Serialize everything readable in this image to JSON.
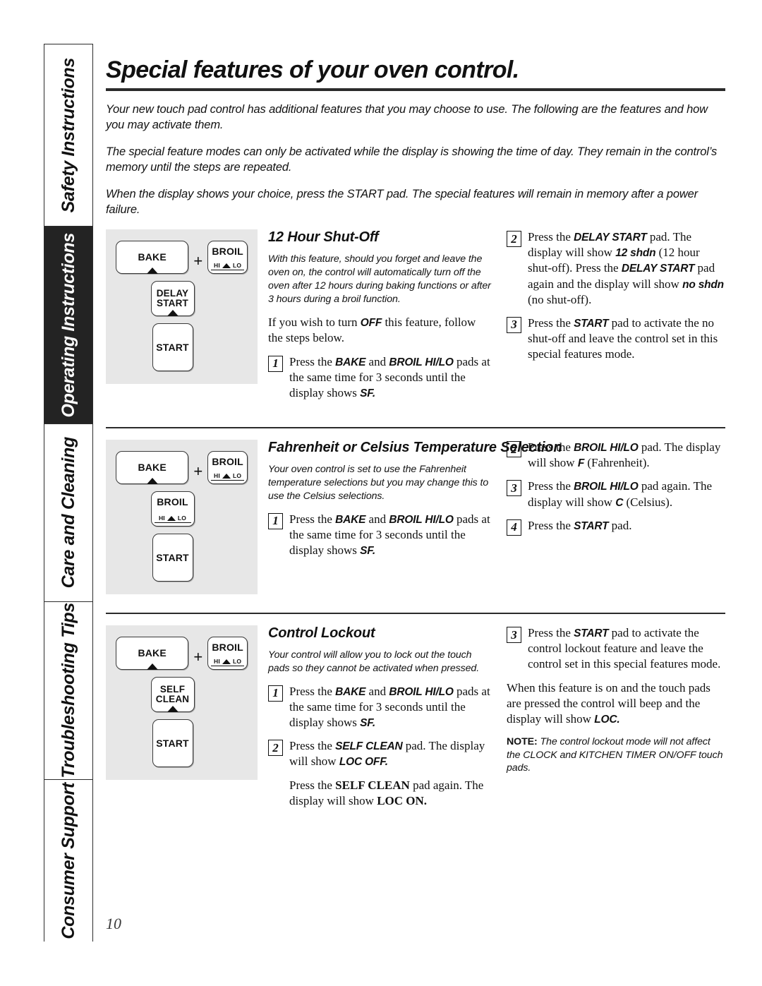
{
  "page": {
    "title": "Special features of your oven control.",
    "number": "10"
  },
  "tabs": [
    {
      "label": "Safety Instructions",
      "active": false
    },
    {
      "label": "Operating Instructions",
      "active": true
    },
    {
      "label": "Care and Cleaning",
      "active": false
    },
    {
      "label": "Troubleshooting Tips",
      "active": false
    },
    {
      "label": "Consumer Support",
      "active": false
    }
  ],
  "intro": {
    "p1": "Your new touch pad control has additional features that you may choose to use. The following are the features and how you may activate them.",
    "p2": "The special feature modes can only be activated while the display is showing the time of day. They remain in the control’s memory until the steps are repeated.",
    "p3": "When the display shows your choice, press the START pad. The special features will remain in memory after a power failure."
  },
  "keys": {
    "bake": "BAKE",
    "broil": "BROIL",
    "hi": "HI",
    "lo": "LO",
    "plus": "+",
    "delay_start_line1": "DELAY",
    "delay_start_line2": "START",
    "self_clean_line1": "SELF",
    "self_clean_line2": "CLEAN",
    "start": "START"
  },
  "sections": [
    {
      "id": "12-hour-shut-off",
      "title": "12 Hour Shut-Off",
      "blurb": "With this feature, should you forget and leave the oven on, the control will automatically turn off the oven after 12 hours during baking functions or after 3 hours during a broil function.",
      "lead_html": "If you wish to turn <b>OFF</b> this feature, follow the steps below.",
      "steps_left": [
        {
          "num": "1",
          "html": "Press the <b>BAKE</b> and <b>BROIL HI/LO</b> pads at the same time for 3 seconds until the display shows <b>SF.</b>"
        }
      ],
      "steps_right": [
        {
          "num": "2",
          "html": "Press the <b>DELAY START</b> pad. The display will show <b>12 shdn</b> (12 hour shut-off). Press the <b>DELAY START</b> pad again and the display will show <b>no shdn</b> (no shut-off)."
        },
        {
          "num": "3",
          "html": "Press the <b>START</b> pad to activate the no shut-off and leave the control set in this special features mode."
        }
      ]
    },
    {
      "id": "fahrenheit-or-celsius",
      "title": "Fahrenheit or Celsius Temperature Selection",
      "blurb": "Your oven control is set to use the Fahrenheit temperature selections but you may change this to use the Celsius selections.",
      "lead_html": "",
      "steps_left": [
        {
          "num": "1",
          "html": "Press the <b>BAKE</b> and <b>BROIL HI/LO</b> pads at the same time for 3 seconds until the display shows <b>SF.</b>"
        }
      ],
      "steps_right": [
        {
          "num": "2",
          "html": "Press the <b>BROIL HI/LO</b> pad. The display will show <b>F</b> (Fahrenheit)."
        },
        {
          "num": "3",
          "html": "Press the <b>BROIL HI/LO</b> pad again. The display will show <b>C</b> (Celsius)."
        },
        {
          "num": "4",
          "html": "Press the <b>START</b> pad."
        }
      ]
    },
    {
      "id": "control-lockout",
      "title": "Control Lockout",
      "blurb": "Your control will allow you to lock out the touch pads so they cannot be activated when pressed.",
      "lead_html": "",
      "steps_left": [
        {
          "num": "1",
          "html": "Press the <b>BAKE</b> and <b>BROIL HI/LO</b> pads at the same time for 3 seconds until the display shows <b>SF.</b>"
        },
        {
          "num": "2",
          "html": "Press the <b>SELF CLEAN</b> pad. The display will show <b>LOC OFF.</b>"
        }
      ],
      "continuation_html": "Press the <b>SELF CLEAN</b> pad again. The display will show <b>LOC ON.</b>",
      "steps_right": [
        {
          "num": "3",
          "html": "Press the <b>START</b> pad to activate the control lockout feature and leave the control set in this special features mode."
        }
      ],
      "closing_html": "When this feature is on and the touch pads are pressed the control will beep and the display will show <b>LOC.</b>",
      "note_html": "<b>NOTE:</b> The control lockout mode will not affect the CLOCK and KITCHEN TIMER ON/OFF touch pads."
    }
  ]
}
